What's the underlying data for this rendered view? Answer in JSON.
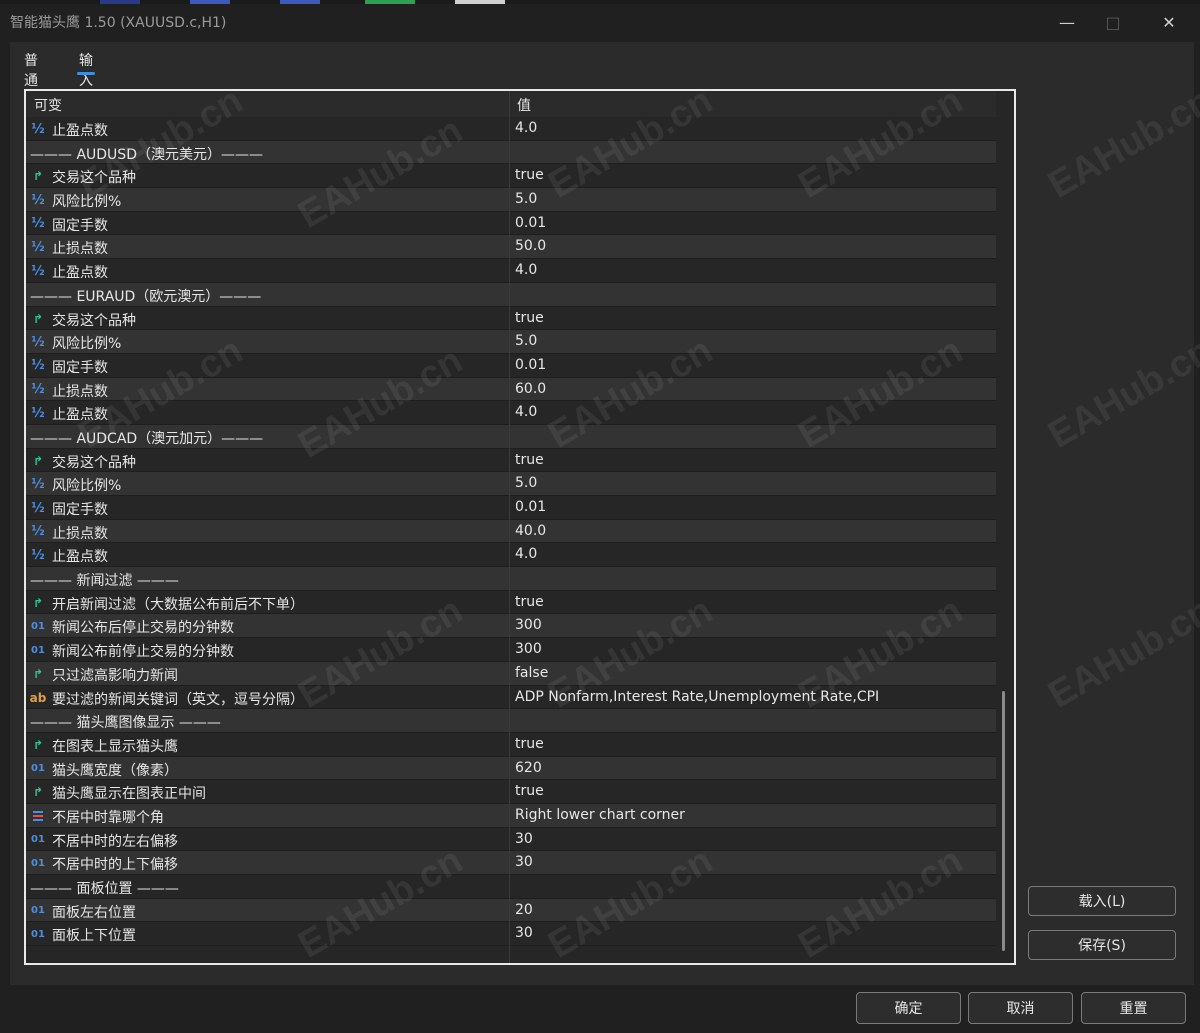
{
  "window": {
    "title": "智能猫头鹰 1.50 (XAUUSD.c,H1)"
  },
  "tabs": [
    {
      "label": "普通"
    },
    {
      "label": "输入"
    }
  ],
  "grid": {
    "header": {
      "variable": "可变",
      "value": "值"
    },
    "rows": [
      {
        "type": "frac",
        "name": "止盈点数",
        "value": "4.0"
      },
      {
        "type": "sep",
        "name": "——— AUDUSD（澳元美元）———",
        "value": ""
      },
      {
        "type": "bool",
        "name": "交易这个品种",
        "value": "true"
      },
      {
        "type": "frac",
        "name": "风险比例%",
        "value": "5.0"
      },
      {
        "type": "frac",
        "name": "固定手数",
        "value": "0.01"
      },
      {
        "type": "frac",
        "name": "止损点数",
        "value": "50.0"
      },
      {
        "type": "frac",
        "name": "止盈点数",
        "value": "4.0"
      },
      {
        "type": "sep",
        "name": "——— EURAUD（欧元澳元）———",
        "value": ""
      },
      {
        "type": "bool",
        "name": "交易这个品种",
        "value": "true"
      },
      {
        "type": "frac",
        "name": "风险比例%",
        "value": "5.0"
      },
      {
        "type": "frac",
        "name": "固定手数",
        "value": "0.01"
      },
      {
        "type": "frac",
        "name": "止损点数",
        "value": "60.0"
      },
      {
        "type": "frac",
        "name": "止盈点数",
        "value": "4.0"
      },
      {
        "type": "sep",
        "name": "——— AUDCAD（澳元加元）———",
        "value": ""
      },
      {
        "type": "bool",
        "name": "交易这个品种",
        "value": "true"
      },
      {
        "type": "frac",
        "name": "风险比例%",
        "value": "5.0"
      },
      {
        "type": "frac",
        "name": "固定手数",
        "value": "0.01"
      },
      {
        "type": "frac",
        "name": "止损点数",
        "value": "40.0"
      },
      {
        "type": "frac",
        "name": "止盈点数",
        "value": "4.0"
      },
      {
        "type": "sep",
        "name": "——— 新闻过滤 ———",
        "value": ""
      },
      {
        "type": "bool",
        "name": "开启新闻过滤（大数据公布前后不下单）",
        "value": "true"
      },
      {
        "type": "int",
        "name": "新闻公布后停止交易的分钟数",
        "value": "300"
      },
      {
        "type": "int",
        "name": "新闻公布前停止交易的分钟数",
        "value": "300"
      },
      {
        "type": "bool",
        "name": "只过滤高影响力新闻",
        "value": "false"
      },
      {
        "type": "str",
        "name": "要过滤的新闻关键词（英文，逗号分隔）",
        "value": "ADP Nonfarm,Interest Rate,Unemployment Rate,CPI"
      },
      {
        "type": "sep",
        "name": "——— 猫头鹰图像显示 ———",
        "value": ""
      },
      {
        "type": "bool",
        "name": "在图表上显示猫头鹰",
        "value": "true"
      },
      {
        "type": "int",
        "name": "猫头鹰宽度（像素）",
        "value": "620"
      },
      {
        "type": "bool",
        "name": "猫头鹰显示在图表正中间",
        "value": "true"
      },
      {
        "type": "enum",
        "name": "不居中时靠哪个角",
        "value": "Right lower chart corner"
      },
      {
        "type": "int",
        "name": "不居中时的左右偏移",
        "value": "30"
      },
      {
        "type": "int",
        "name": "不居中时的上下偏移",
        "value": "30"
      },
      {
        "type": "sep",
        "name": "——— 面板位置 ———",
        "value": ""
      },
      {
        "type": "int",
        "name": "面板左右位置",
        "value": "20"
      },
      {
        "type": "int",
        "name": "面板上下位置",
        "value": "30"
      }
    ]
  },
  "icons": {
    "frac": "½",
    "bool": "↱",
    "int": "01",
    "str": "ab",
    "enum": "≡"
  },
  "buttons": {
    "load": "载入(L)",
    "save": "保存(S)",
    "ok": "确定",
    "cancel": "取消",
    "reset": "重置"
  },
  "watermark": "EAHub.cn",
  "colors": {
    "accent": "#3f8fe0",
    "bool_icon": "#2fc48d",
    "num_icon": "#4e8ee0",
    "str_icon": "#e0a040"
  }
}
